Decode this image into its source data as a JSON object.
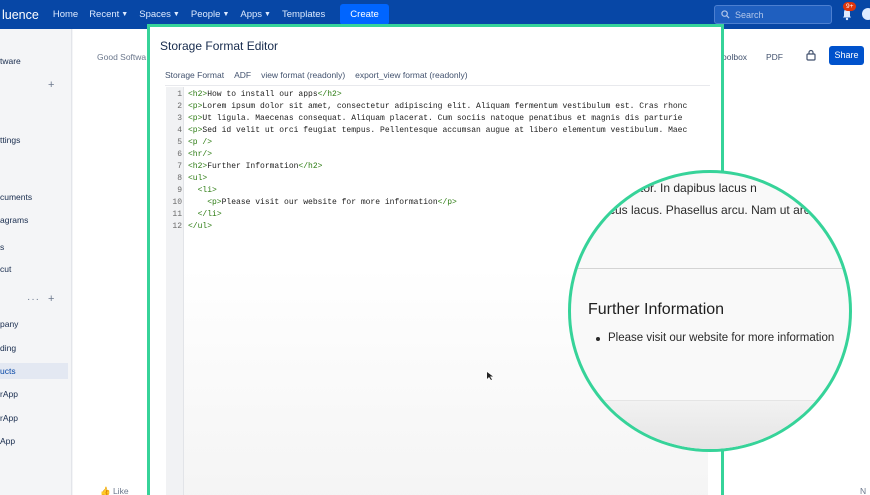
{
  "topnav": {
    "brand": "luence",
    "items": [
      {
        "label": "Home",
        "chevron": false
      },
      {
        "label": "Recent",
        "chevron": true
      },
      {
        "label": "Spaces",
        "chevron": true
      },
      {
        "label": "People",
        "chevron": true
      },
      {
        "label": "Apps",
        "chevron": true
      },
      {
        "label": "Templates",
        "chevron": false
      }
    ],
    "create_label": "Create",
    "search_placeholder": "Search",
    "notification_badge": "9+"
  },
  "sidebar": {
    "items": [
      "tware",
      "ttings",
      "cuments",
      "agrams",
      "s",
      "cut",
      "pany",
      "ding",
      "ucts",
      "rApp",
      "rApp",
      "App",
      ""
    ]
  },
  "page": {
    "breadcrumb": "Good Softwa",
    "toolbox_label": "oolbox",
    "pdf_label": "PDF",
    "share_label": "Share",
    "like_label": "Like",
    "right_bottom": "N"
  },
  "modal": {
    "title": "Storage Format Editor",
    "tabs": [
      "Storage Format",
      "ADF",
      "view format (readonly)",
      "export_view format (readonly)"
    ]
  },
  "code_lines": [
    {
      "n": "1",
      "indent": "",
      "parts": [
        [
          "t",
          "<h2>"
        ],
        [
          "x",
          "How to install our apps"
        ],
        [
          "t",
          "</h2>"
        ]
      ]
    },
    {
      "n": "2",
      "indent": "",
      "parts": [
        [
          "t",
          "<p>"
        ],
        [
          "x",
          "Lorem ipsum dolor sit amet, consectetur adipiscing elit. Aliquam fermentum vestibulum est. Cras rhonc"
        ]
      ]
    },
    {
      "n": "3",
      "indent": "",
      "parts": [
        [
          "t",
          "<p>"
        ],
        [
          "x",
          "Ut ligula. Maecenas consequat. Aliquam placerat. Cum sociis natoque penatibus et magnis dis parturie"
        ]
      ]
    },
    {
      "n": "4",
      "indent": "",
      "parts": [
        [
          "t",
          "<p>"
        ],
        [
          "x",
          "Sed id velit ut orci feugiat tempus. Pellentesque accumsan augue at libero elementum vestibulum. Maec"
        ]
      ]
    },
    {
      "n": "5",
      "indent": "",
      "parts": [
        [
          "t",
          "<p />"
        ]
      ]
    },
    {
      "n": "6",
      "indent": "",
      "parts": [
        [
          "t",
          "<hr/>"
        ]
      ]
    },
    {
      "n": "7",
      "indent": "",
      "parts": [
        [
          "t",
          "<h2>"
        ],
        [
          "x",
          "Further Information"
        ],
        [
          "t",
          "</h2>"
        ]
      ]
    },
    {
      "n": "8",
      "indent": "",
      "parts": [
        [
          "t",
          "<ul>"
        ]
      ]
    },
    {
      "n": "9",
      "indent": "  ",
      "parts": [
        [
          "t",
          "<li>"
        ]
      ]
    },
    {
      "n": "10",
      "indent": "    ",
      "parts": [
        [
          "t",
          "<p>"
        ],
        [
          "x",
          "Please visit our website for more information"
        ],
        [
          "t",
          "</p>"
        ]
      ]
    },
    {
      "n": "11",
      "indent": "  ",
      "parts": [
        [
          "t",
          "</li>"
        ]
      ]
    },
    {
      "n": "12",
      "indent": "",
      "parts": [
        [
          "t",
          "</ul>"
        ]
      ]
    }
  ],
  "magnifier": {
    "line1": "d tortor. In dapibus lacus n",
    "line2": "cus lacus. Phasellus arcu. Nam ut arcu.",
    "heading": "Further Information",
    "list_item": "Please visit our website for more information"
  }
}
